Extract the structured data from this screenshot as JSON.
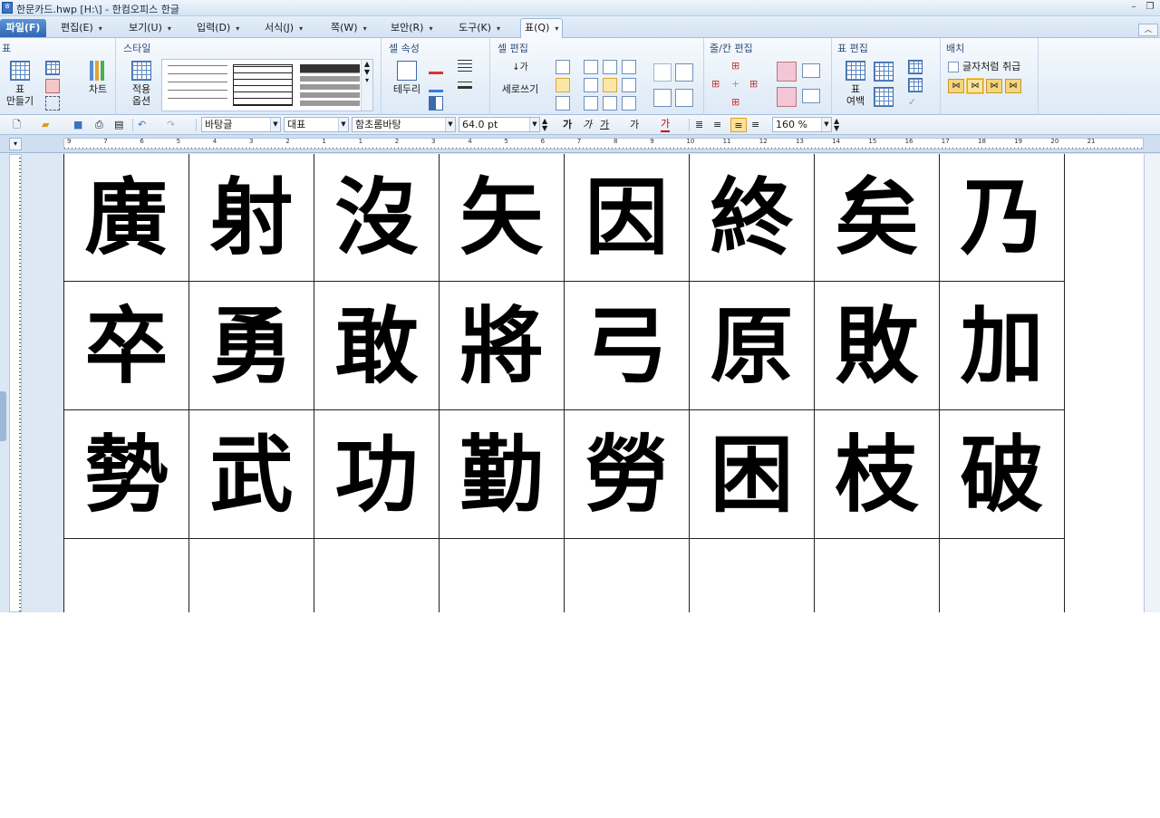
{
  "titlebar": {
    "title": "한문카드.hwp [H:\\] - 한컴오피스 한글"
  },
  "menu": {
    "file": "파일(F)",
    "tabs": [
      "편집(E)",
      "보기(U)",
      "입력(D)",
      "서식(J)",
      "쪽(W)",
      "보안(R)",
      "도구(K)",
      "표(Q)"
    ],
    "active_tab": "표(Q)"
  },
  "ribbon": {
    "groups": {
      "table": "표",
      "style": "스타일",
      "cell_props": "셀 속성",
      "cell_edit": "셀 편집",
      "row_col_edit": "줄/칸 편집",
      "table_edit": "표 편집",
      "arrange": "배치"
    },
    "buttons": {
      "make_table": "표\n만들기",
      "chart": "차트",
      "apply_options": "적용\n옵션",
      "border": "테두리",
      "vertical_write": "세로쓰기",
      "table_margin": "표\n여백",
      "treat_as_char": "글자처럼 취급"
    }
  },
  "format_bar": {
    "style": "바탕글",
    "lang": "대표",
    "font": "함초롬바탕",
    "size": "64.0",
    "size_unit": "pt",
    "bold": "가",
    "italic": "가",
    "underline": "가",
    "strike": "가",
    "color": "가",
    "line_spacing": "160",
    "line_spacing_unit": "%"
  },
  "ruler": {
    "numbers": [
      "9",
      "7",
      "6",
      "5",
      "4",
      "3",
      "2",
      "1",
      "1",
      "2",
      "3",
      "4",
      "5",
      "6",
      "7",
      "8",
      "9",
      "10",
      "11",
      "12",
      "13",
      "14",
      "15",
      "16",
      "17",
      "18",
      "19",
      "20",
      "21"
    ]
  },
  "document": {
    "rows": [
      [
        "廣",
        "射",
        "沒",
        "矢",
        "因",
        "終",
        "矣",
        "乃"
      ],
      [
        "卒",
        "勇",
        "敢",
        "將",
        "弓",
        "原",
        "敗",
        "加"
      ],
      [
        "勢",
        "武",
        "功",
        "勤",
        "勞",
        "困",
        "枝",
        "破"
      ],
      [
        "",
        "",
        "",
        "",
        "",
        "",
        "",
        ""
      ]
    ]
  }
}
